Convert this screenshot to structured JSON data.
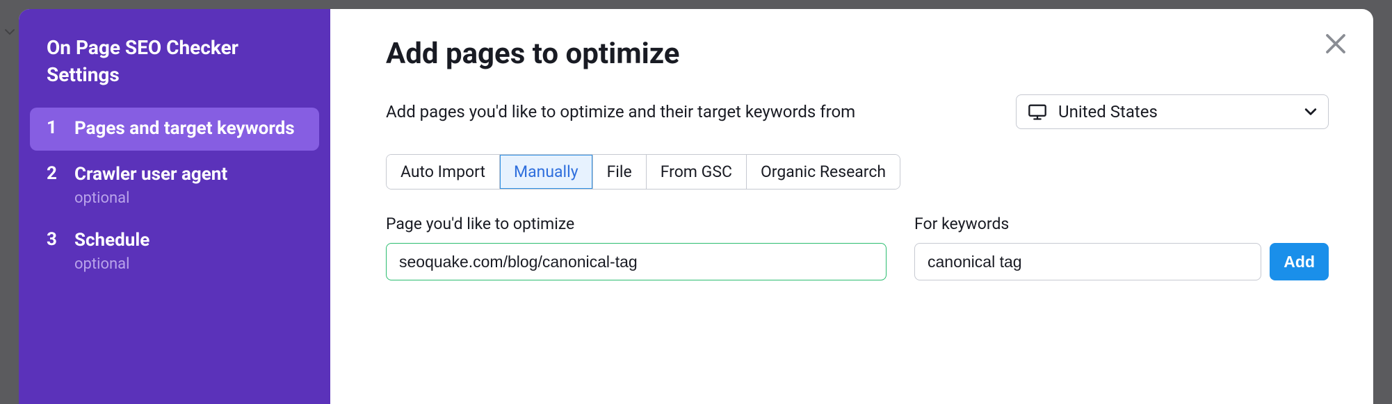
{
  "sidebar": {
    "title": "On Page SEO Checker Settings",
    "items": [
      {
        "num": "1",
        "label": "Pages and target keywords",
        "subtext": "",
        "active": true
      },
      {
        "num": "2",
        "label": "Crawler user agent",
        "subtext": "optional",
        "active": false
      },
      {
        "num": "3",
        "label": "Schedule",
        "subtext": "optional",
        "active": false
      }
    ]
  },
  "main": {
    "title": "Add pages to optimize",
    "description": "Add pages you'd like to optimize and their target keywords from",
    "country": {
      "name": "United States"
    },
    "tabs": [
      {
        "label": "Auto Import",
        "active": false
      },
      {
        "label": "Manually",
        "active": true
      },
      {
        "label": "File",
        "active": false
      },
      {
        "label": "From GSC",
        "active": false
      },
      {
        "label": "Organic Research",
        "active": false
      }
    ],
    "form": {
      "page_label": "Page you'd like to optimize",
      "page_value": "seoquake.com/blog/canonical-tag",
      "kw_label": "For keywords",
      "kw_value": "canonical tag",
      "add_label": "Add"
    }
  }
}
